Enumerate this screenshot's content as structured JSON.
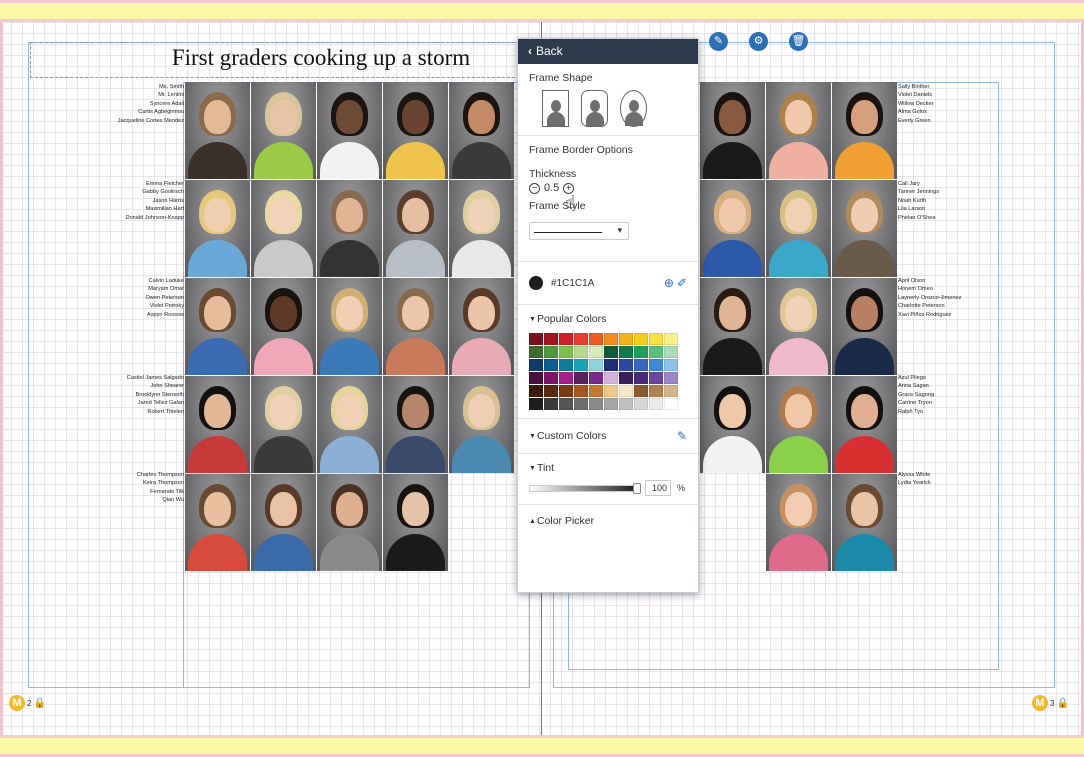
{
  "page": {
    "title": "First graders cooking up a storm",
    "left_page_number": "2",
    "right_page_number": "3",
    "master_badge": "M"
  },
  "toolbar": {
    "icons": [
      "pencil-icon",
      "gear-icon",
      "trash-icon"
    ]
  },
  "panel": {
    "back_label": "Back",
    "frame_shape_label": "Frame Shape",
    "border_options_label": "Frame Border Options",
    "thickness_label": "Thickness",
    "thickness_value": "0.5",
    "frame_style_label": "Frame Style",
    "current_color": "#1C1C1A",
    "popular_colors_label": "Popular Colors",
    "custom_colors_label": "Custom Colors",
    "tint_label": "Tint",
    "tint_value": "100",
    "tint_unit": "%",
    "color_picker_label": "Color Picker",
    "palette": [
      "#7a1120",
      "#a4151e",
      "#d21f2a",
      "#e83f2f",
      "#ee5a24",
      "#f28c1e",
      "#f5b01c",
      "#f7cd1a",
      "#f6df40",
      "#f7ef8a",
      "#3a6b2a",
      "#4e9a3a",
      "#7cc04a",
      "#b5d98a",
      "#d8eab8",
      "#0e5e3b",
      "#127a4a",
      "#1aa35c",
      "#58c17e",
      "#a9dcb8",
      "#0d3a6b",
      "#0e5b8f",
      "#127a9e",
      "#1aa3b8",
      "#8fd3dc",
      "#1e2d7a",
      "#2a48a8",
      "#3466c2",
      "#3a8ad6",
      "#8ec1ea",
      "#4a0f3a",
      "#7a1466",
      "#a81e8a",
      "#5a2060",
      "#7a2a8a",
      "#d6b3dc",
      "#3b1f5a",
      "#4a2a7a",
      "#6a44a0",
      "#9a86c8",
      "#3a1a0c",
      "#5a2a10",
      "#7a3a14",
      "#a8541e",
      "#c8782e",
      "#f0c88a",
      "#f5e6c8",
      "#8a5a2a",
      "#b08050",
      "#d6b48a",
      "#1c1c1a",
      "#3a3a3a",
      "#555555",
      "#6e6e6e",
      "#8a8a8a",
      "#a5a5a5",
      "#c0c0c0",
      "#d6d6d6",
      "#ebebeb",
      "#ffffff"
    ]
  },
  "names": {
    "left": [
      [
        "Ms. Smith",
        "Mr. Lentini",
        "Syncere Adali",
        "Curtis Agbeginnou",
        "Jacqueline Cortes Mendez"
      ],
      [
        "Emma Fletcher",
        "Gabby Goolirsch",
        "Jason Harris",
        "Maximilian Hart",
        "Donald Johnson-Knapp"
      ],
      [
        "Calvin Laduke",
        "Maryam Omar",
        "Owen Peterson",
        "Violet Petroky",
        "Aspyn Rossow"
      ],
      [
        "Castiel James Salgado",
        "John Shearer",
        "Brooklynn Stenseth",
        "Jared Tellez Galan",
        "Robert Thielen"
      ],
      [
        "Charles Thompson",
        "Keira Thompson",
        "Fernando Tilk",
        "Qian Wu"
      ]
    ],
    "right": [
      [
        "Sally Binther",
        "Violet Daniels",
        "Willow Decker",
        "Alma Golos",
        "Everly Green"
      ],
      [
        "Cali Jary",
        "Tanner Jennings",
        "Noah Kurth",
        "Lila Larson",
        "Phelan O'Shea"
      ],
      [
        "April Olson",
        "Honem Omeo",
        "Laynerly Orozco-Jimenez",
        "Charlotte Peterson",
        "Xavi Piños Rodriguez"
      ],
      [
        "Azul Pliego",
        "Anna Sagan",
        "Grace Sagong",
        "Carrine Tryon",
        "Ralph Tyo"
      ],
      [
        "Alyssa White",
        "Lydia Yearick"
      ]
    ]
  },
  "photos": {
    "left": [
      [
        [
          "#8a6a48",
          "#e5b896",
          "#3b2f2a"
        ],
        [
          "#d8c59a",
          "#e9c4a4",
          "#9acb45"
        ],
        [
          "#1c1410",
          "#6e4a34",
          "#f2f2f2"
        ],
        [
          "#1c1410",
          "#6a4430",
          "#f0c44a"
        ],
        [
          "#1c1410",
          "#c48a64",
          "#3a3a3a"
        ]
      ],
      [
        [
          "#e8c878",
          "#f0cfb0",
          "#6aa8d8"
        ],
        [
          "#ead9a0",
          "#f3d3b8",
          "#c9c9c9"
        ],
        [
          "#8a6a4e",
          "#e2b494",
          "#333333"
        ],
        [
          "#5a3e2a",
          "#e7bea0",
          "#b8bec6"
        ],
        [
          "#e2cfa0",
          "#f0d2b6",
          "#e8e8e8"
        ]
      ],
      [
        [
          "#6a4a30",
          "#e6bc9c",
          "#3a6ab0"
        ],
        [
          "#1a120e",
          "#5e3a26",
          "#f0a8b8"
        ],
        [
          "#d0b070",
          "#f2cfb2",
          "#3a7ab8"
        ],
        [
          "#8a6a4a",
          "#ecc6a8",
          "#c87a5a"
        ],
        [
          "#5a3a26",
          "#ecc4a8",
          "#e8aab4"
        ]
      ],
      [
        [
          "#141010",
          "#e2b896",
          "#c83a3a"
        ],
        [
          "#e2cfa0",
          "#f2d2b6",
          "#3a3a3a"
        ],
        [
          "#e6d49a",
          "#f2d0b4",
          "#8ab0d8"
        ],
        [
          "#1a1410",
          "#b8846a",
          "#3a4a6a"
        ],
        [
          "#d8c090",
          "#f0ceb2",
          "#4a8ab0"
        ]
      ],
      [
        [
          "#6a4a30",
          "#e8c0a0",
          "#d84a3a"
        ],
        [
          "#5a3a26",
          "#eac2a4",
          "#3a6aa8"
        ],
        [
          "#4a3022",
          "#deb08e",
          "#8a8a8a"
        ],
        [
          "#1a120e",
          "#e6c2a6",
          "#1a1a1a"
        ],
        null
      ]
    ],
    "right": [
      [
        [
          "#1a120e",
          "#8a5a40",
          "#1a1a1a"
        ],
        [
          "#b0804a",
          "#f0c8aa",
          "#f0b0a0"
        ],
        [
          "#1a120e",
          "#d6a07a",
          "#f0a030"
        ]
      ],
      [
        [
          "#d8b080",
          "#f0c8aa",
          "#2a5aa8"
        ],
        [
          "#d8c080",
          "#f2d0b2",
          "#3aa8c8"
        ],
        [
          "#b08a5a",
          "#f0ccb0",
          "#6a5a4a"
        ]
      ],
      [
        [
          "#2a1a12",
          "#e0b494",
          "#1a1a1a"
        ],
        [
          "#e0c890",
          "#f2d2b6",
          "#f0b8c8"
        ],
        [
          "#141010",
          "#b88060",
          "#1a2a4a"
        ]
      ],
      [
        [
          "#141010",
          "#f0c8a8",
          "#f2f2f2"
        ],
        [
          "#b07a4a",
          "#f0c8a8",
          "#8ad048"
        ],
        [
          "#141010",
          "#e2b090",
          "#d83030"
        ]
      ],
      [
        null,
        [
          "#c89060",
          "#f2cdb0",
          "#e06a8a"
        ],
        [
          "#6a4a30",
          "#eac4a4",
          "#1a8aa8"
        ]
      ]
    ]
  }
}
